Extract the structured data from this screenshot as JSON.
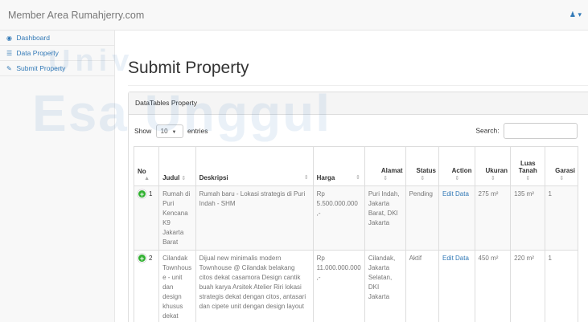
{
  "navbar": {
    "brand": "Member Area Rumahjerry.com",
    "user_icon": "user-icon",
    "user_caret": "▾"
  },
  "sidebar": {
    "items": [
      {
        "icon": "dashboard-icon",
        "glyph": "◉",
        "label": "Dashboard"
      },
      {
        "icon": "table-icon",
        "glyph": "☰",
        "label": "Data Property"
      },
      {
        "icon": "edit-icon",
        "glyph": "✎",
        "label": "Submit Property"
      }
    ]
  },
  "page": {
    "title": "Submit Property",
    "panel_heading": "DataTables Property"
  },
  "datatable": {
    "show_label": "Show",
    "length_value": "10",
    "entries_label": "entries",
    "search_label": "Search:",
    "search_value": "",
    "columns": [
      {
        "label": "No",
        "sort": "▲"
      },
      {
        "label": "Judul",
        "sort": "⇕"
      },
      {
        "label": "Deskripsi",
        "sort": "⇕"
      },
      {
        "label": "Harga",
        "sort": "⇕"
      },
      {
        "label": "Alamat",
        "sort": "⇕"
      },
      {
        "label": "Status",
        "sort": "⇕"
      },
      {
        "label": "Action",
        "sort": "⇕"
      },
      {
        "label": "Ukuran",
        "sort": "⇕"
      },
      {
        "label": "Luas Tanah",
        "sort": "⇕"
      },
      {
        "label": "Garasi",
        "sort": "⇕"
      }
    ],
    "rows": [
      {
        "no": "1",
        "judul": "Rumah di Puri Kencana K9 Jakarta Barat",
        "deskripsi": "Rumah baru - Lokasi strategis di Puri Indah - SHM",
        "harga": "Rp 5.500.000.000 ,-",
        "alamat": "Puri Indah, Jakarta Barat, DKI Jakarta",
        "status": "Pending",
        "action": "Edit Data",
        "ukuran": "275 m²",
        "luas_tanah": "135 m²",
        "garasi": "1"
      },
      {
        "no": "2",
        "judul": "Cilandak Townhouse - unit dan design khusus dekat Citos",
        "deskripsi": "Dijual new minimalis modern Townhouse @ Cilandak belakang citos dekat casamora Design cantik buah karya Arsitek Atelier Riri lokasi strategis dekat dengan citos, antasari dan cipete unit dengan design layout",
        "harga": "Rp 11.000.000.000 ,-",
        "alamat": "Cilandak, Jakarta Selatan, DKI Jakarta",
        "status": "Aktif",
        "action": "Edit Data",
        "ukuran": "450 m²",
        "luas_tanah": "220 m²",
        "garasi": "1"
      }
    ]
  },
  "watermark": {
    "line1": "Esa Unggul",
    "line2": "Univ"
  }
}
